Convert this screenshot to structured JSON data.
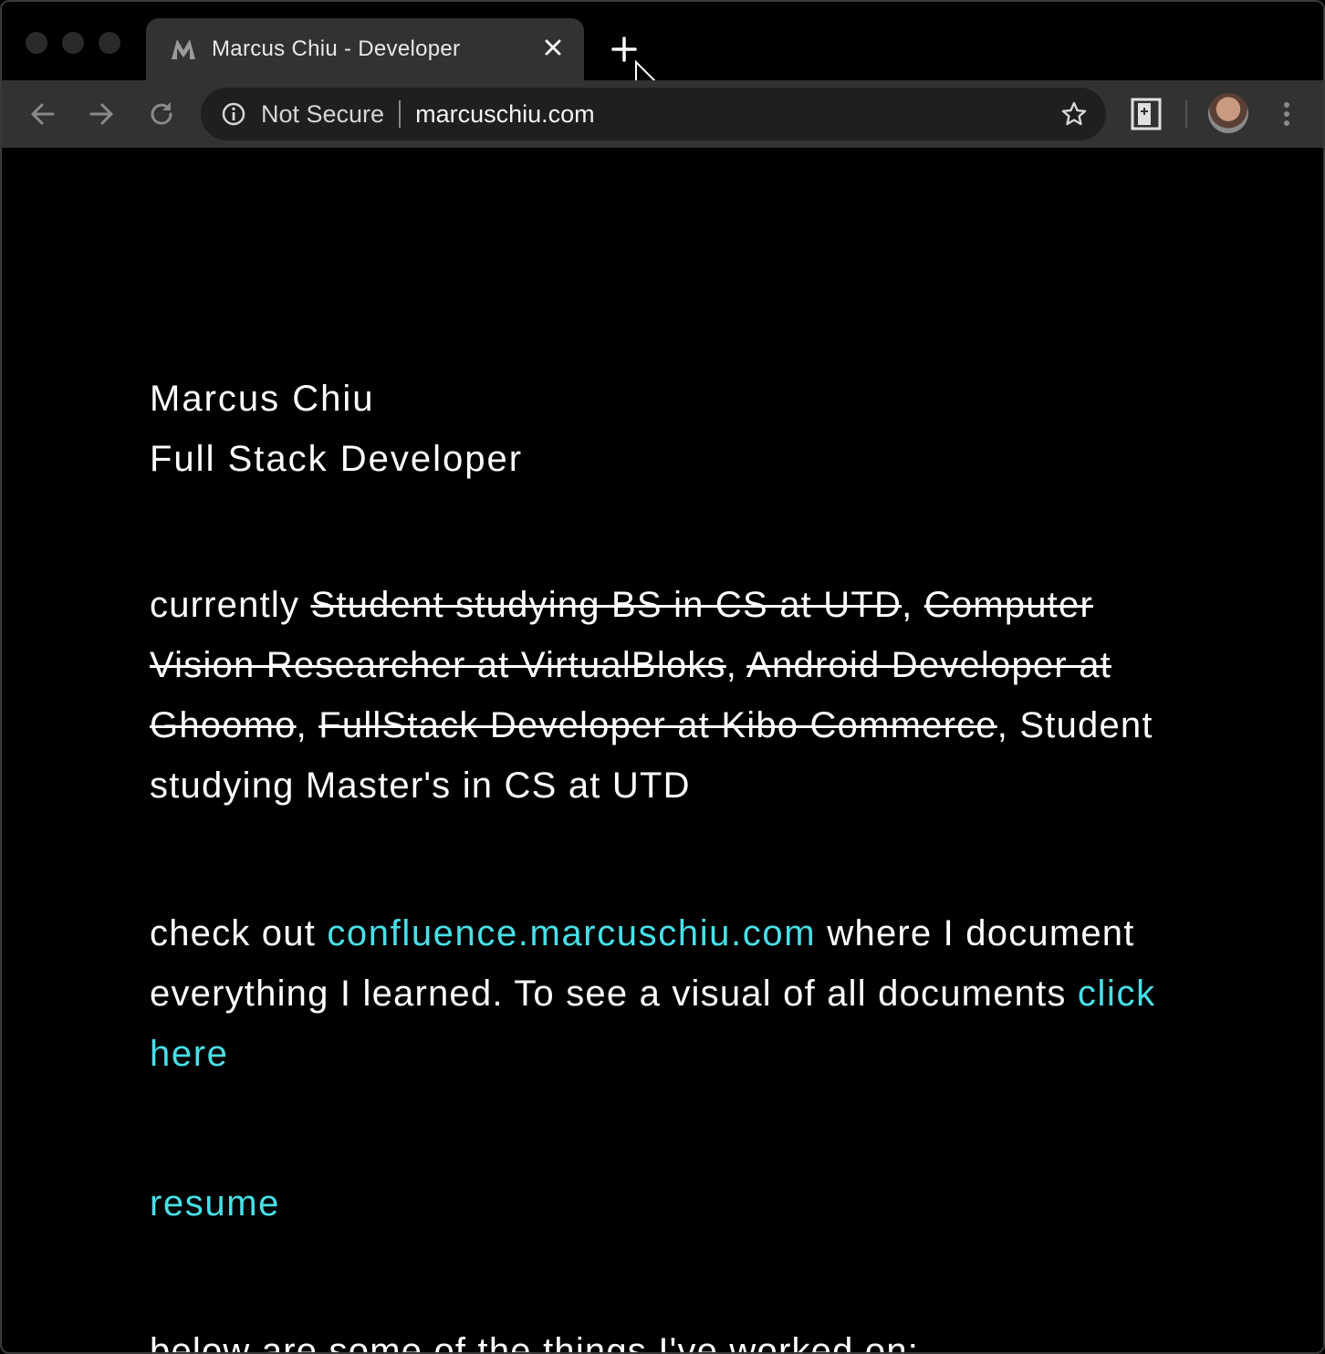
{
  "browser": {
    "tab_title": "Marcus Chiu - Developer",
    "security_label": "Not Secure",
    "url": "marcuschiu.com"
  },
  "icons": {
    "close": "close-icon",
    "new_tab": "plus-icon",
    "back": "back-arrow-icon",
    "forward": "forward-arrow-icon",
    "reload": "reload-icon",
    "info": "info-icon",
    "bookmark": "star-icon",
    "extension": "bookmark-extension-icon",
    "menu": "more-vert-icon"
  },
  "colors": {
    "link": "#48e0e8",
    "background": "#000000",
    "text": "#ffffff"
  },
  "page": {
    "name": "Marcus Chiu",
    "role": "Full Stack Developer",
    "currently_prefix": "currently ",
    "past_roles": [
      "Student studying BS in CS at UTD",
      "Computer Vision Researcher at VirtualBloks",
      "Android Developer at Ghoomo",
      "FullStack Developer at Kibo Commerce"
    ],
    "current_role": "Student studying Master's in CS at UTD",
    "checkout_prefix": "check out ",
    "confluence_link": "confluence.marcuschiu.com",
    "checkout_middle": " where I document everything I learned. To see a visual of all documents ",
    "click_here": "click here",
    "resume": "resume",
    "below_text": "below are some of the things I've worked on:"
  }
}
